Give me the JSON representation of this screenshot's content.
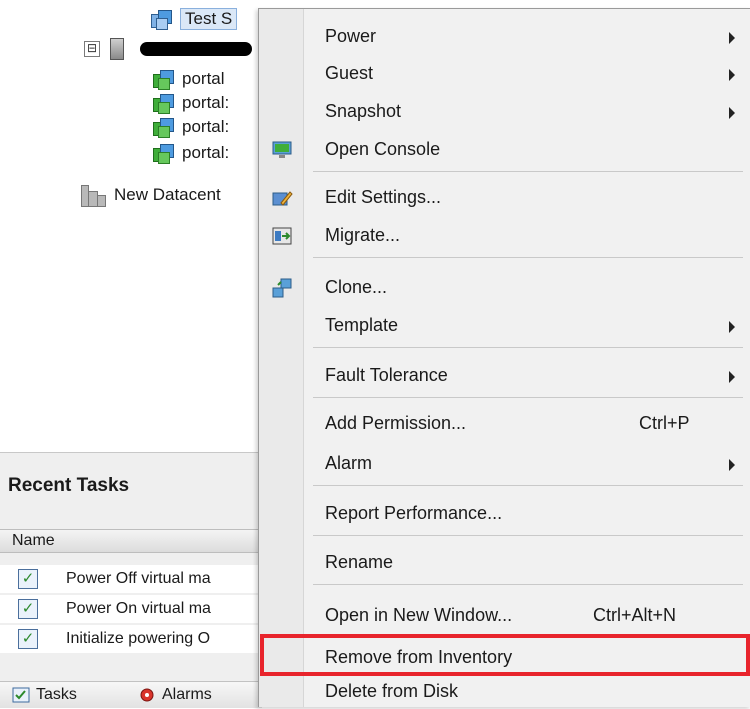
{
  "tree": {
    "top_item": "Test S",
    "vms": [
      "portal",
      "portal:",
      "portal:",
      "portal:"
    ],
    "datacenter": "New Datacent",
    "expander_symbol": "⊟"
  },
  "recent_tasks": {
    "title": "Recent Tasks",
    "column_name": "Name",
    "rows": [
      "Power Off virtual ma",
      "Power On virtual ma",
      "Initialize powering O"
    ],
    "tabs": [
      "Tasks",
      "Alarms"
    ]
  },
  "context_menu": {
    "items": {
      "power": "Power",
      "guest": "Guest",
      "snapshot": "Snapshot",
      "open_console": "Open Console",
      "edit_settings": "Edit Settings...",
      "migrate": "Migrate...",
      "clone": "Clone...",
      "template": "Template",
      "fault_tolerance": "Fault Tolerance",
      "add_permission": "Add Permission...",
      "add_permission_shortcut": "Ctrl+P",
      "alarm": "Alarm",
      "report_performance": "Report Performance...",
      "rename": "Rename",
      "open_new_window": "Open in New Window...",
      "open_new_window_shortcut": "Ctrl+Alt+N",
      "remove_inventory": "Remove from Inventory",
      "delete_disk": "Delete from Disk"
    }
  },
  "colors": {
    "highlight_border": "#e8242c",
    "menu_background": "#f1f1f1",
    "tasks_background": "#efefef"
  }
}
